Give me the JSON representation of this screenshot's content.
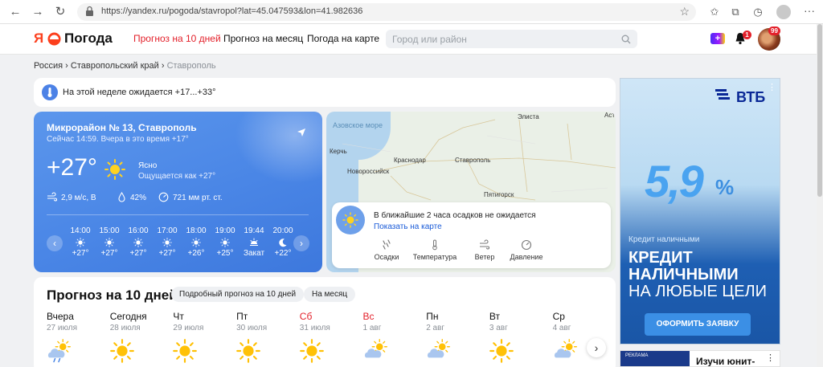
{
  "browser": {
    "url": "https://yandex.ru/pogoda/stavropol?lat=45.047593&lon=41.982636"
  },
  "header": {
    "logo_ya": "Я",
    "logo_text": "Погода",
    "nav": [
      "Прогноз на 10 дней",
      "Прогноз на месяц",
      "Погода на карте"
    ],
    "search_placeholder": "Город или район",
    "notifications_count": "1",
    "avatar_count": "99"
  },
  "breadcrumb": {
    "items": [
      "Россия",
      "Ставропольский край",
      "Ставрополь"
    ],
    "separator": "›"
  },
  "alert": {
    "text": "На этой неделе ожидается +17...+33°"
  },
  "current": {
    "place": "Микрорайон № 13, Ставрополь",
    "subtitle": "Сейчас 14:59. Вчера в это время +17°",
    "temp": "+27°",
    "condition": "Ясно",
    "feels_like": "Ощущается как +27°",
    "wind": "2,9 м/с, В",
    "humidity": "42%",
    "pressure": "721 мм рт. ст.",
    "hours": [
      {
        "time": "14:00",
        "temp": "+27°",
        "icon": "sun-icon"
      },
      {
        "time": "15:00",
        "temp": "+27°",
        "icon": "sun-icon"
      },
      {
        "time": "16:00",
        "temp": "+27°",
        "icon": "sun-icon"
      },
      {
        "time": "17:00",
        "temp": "+27°",
        "icon": "sun-icon"
      },
      {
        "time": "18:00",
        "temp": "+26°",
        "icon": "sun-icon"
      },
      {
        "time": "19:00",
        "temp": "+25°",
        "icon": "sun-icon"
      },
      {
        "time": "19:44",
        "temp": "Закат",
        "icon": "sunset-icon"
      },
      {
        "time": "20:00",
        "temp": "+22°",
        "icon": "moon-icon"
      }
    ]
  },
  "map": {
    "labels": [
      "Азовское море",
      "Керчь",
      "Краснодар",
      "Новороссийск",
      "Ставрополь",
      "Элиста",
      "Пятигорск",
      "Аст"
    ],
    "precip_text": "В ближайшие 2 часа осадков не ожидается",
    "precip_link": "Показать на карте",
    "tabs": [
      "Осадки",
      "Температура",
      "Ветер",
      "Давление"
    ]
  },
  "forecast": {
    "title": "Прогноз на 10 дней",
    "chip_detail": "Подробный прогноз на 10 дней",
    "chip_month": "На месяц",
    "days": [
      {
        "name": "Вчера",
        "date": "27 июля",
        "icon": "partly-cloudy-rain-icon",
        "weekend": false
      },
      {
        "name": "Сегодня",
        "date": "28 июля",
        "icon": "sun-icon",
        "weekend": false
      },
      {
        "name": "Чт",
        "date": "29 июля",
        "icon": "sun-icon",
        "weekend": false
      },
      {
        "name": "Пт",
        "date": "30 июля",
        "icon": "sun-icon",
        "weekend": false
      },
      {
        "name": "Сб",
        "date": "31 июля",
        "icon": "sun-icon",
        "weekend": true
      },
      {
        "name": "Вс",
        "date": "1 авг",
        "icon": "partly-cloudy-icon",
        "weekend": true
      },
      {
        "name": "Пн",
        "date": "2 авг",
        "icon": "partly-cloudy-icon",
        "weekend": false
      },
      {
        "name": "Вт",
        "date": "3 авг",
        "icon": "sun-icon",
        "weekend": false
      },
      {
        "name": "Ср",
        "date": "4 авг",
        "icon": "partly-cloudy-icon",
        "weekend": false
      }
    ]
  },
  "ad": {
    "brand": "ВТБ",
    "rate": "5,9",
    "rate_suffix": "%",
    "small": "Кредит наличными",
    "big_line1": "КРЕДИТ",
    "big_line2": "НАЛИЧНЫМИ",
    "big_line3": "НА ЛЮБЫЕ ЦЕЛИ",
    "cta": "ОФОРМИТЬ ЗАЯВКУ"
  },
  "ad2": {
    "tag": "РЕКЛАМА",
    "title": "Изучи юнит-"
  },
  "colors": {
    "accent_red": "#e3202a",
    "card_blue": "#4a86e6",
    "link_blue": "#1a5bd8"
  }
}
